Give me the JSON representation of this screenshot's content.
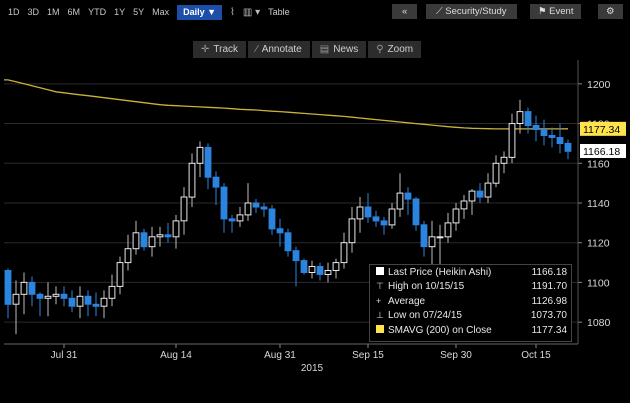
{
  "toolbar": {
    "ranges": [
      "1D",
      "3D",
      "1M",
      "6M",
      "YTD",
      "1Y",
      "5Y",
      "Max"
    ],
    "frequency": "Daily ▼",
    "table_label": "Table",
    "security_study_label": "Security/Study",
    "event_label": "Event"
  },
  "toolbar2": {
    "track": "Track",
    "annotate": "Annotate",
    "news": "News",
    "zoom": "Zoom"
  },
  "legend": {
    "last_price_label": "Last Price (Heikin Ashi)",
    "last_price_value": "1166.18",
    "high_label": "High on 10/15/15",
    "high_value": "1191.70",
    "average_label": "Average",
    "average_value": "1126.98",
    "low_label": "Low on 07/24/15",
    "low_value": "1073.70",
    "sma_label": "SMAVG (200) on Close",
    "sma_value": "1177.34"
  },
  "colors": {
    "up": "#ffffff",
    "down": "#2b84e0",
    "sma": "#c9b23c",
    "sma_tag": "#ffe34d",
    "freq_bg": "#1e4fa8"
  },
  "chart_data": {
    "type": "candlestick",
    "style": "Heikin Ashi",
    "x_tick_labels": [
      "Jul 31",
      "Aug 14",
      "Aug 31",
      "Sep 15",
      "Sep 30",
      "Oct 15"
    ],
    "year_label": "2015",
    "y_ticks": [
      1080,
      1100,
      1120,
      1140,
      1160,
      1180,
      1200
    ],
    "ylim": [
      1069,
      1212
    ],
    "last_price_tag": "1166.18",
    "sma_tag": "1177.34",
    "candles": [
      {
        "o": 1106,
        "h": 1107,
        "l": 1082,
        "c": 1089
      },
      {
        "o": 1089,
        "h": 1101,
        "l": 1074,
        "c": 1094
      },
      {
        "o": 1094,
        "h": 1105,
        "l": 1084,
        "c": 1100
      },
      {
        "o": 1100,
        "h": 1103,
        "l": 1088,
        "c": 1094
      },
      {
        "o": 1094,
        "h": 1095,
        "l": 1083,
        "c": 1092
      },
      {
        "o": 1092,
        "h": 1100,
        "l": 1083,
        "c": 1093
      },
      {
        "o": 1093,
        "h": 1098,
        "l": 1089,
        "c": 1094
      },
      {
        "o": 1094,
        "h": 1098,
        "l": 1088,
        "c": 1092
      },
      {
        "o": 1092,
        "h": 1096,
        "l": 1085,
        "c": 1088
      },
      {
        "o": 1088,
        "h": 1098,
        "l": 1082,
        "c": 1093
      },
      {
        "o": 1093,
        "h": 1096,
        "l": 1083,
        "c": 1089
      },
      {
        "o": 1089,
        "h": 1095,
        "l": 1083,
        "c": 1088
      },
      {
        "o": 1088,
        "h": 1096,
        "l": 1082,
        "c": 1092
      },
      {
        "o": 1092,
        "h": 1104,
        "l": 1088,
        "c": 1098
      },
      {
        "o": 1098,
        "h": 1113,
        "l": 1094,
        "c": 1110
      },
      {
        "o": 1110,
        "h": 1124,
        "l": 1106,
        "c": 1117
      },
      {
        "o": 1117,
        "h": 1131,
        "l": 1114,
        "c": 1125
      },
      {
        "o": 1125,
        "h": 1127,
        "l": 1116,
        "c": 1118
      },
      {
        "o": 1118,
        "h": 1128,
        "l": 1113,
        "c": 1123
      },
      {
        "o": 1123,
        "h": 1128,
        "l": 1118,
        "c": 1124
      },
      {
        "o": 1124,
        "h": 1130,
        "l": 1120,
        "c": 1123
      },
      {
        "o": 1123,
        "h": 1134,
        "l": 1117,
        "c": 1131
      },
      {
        "o": 1131,
        "h": 1148,
        "l": 1124,
        "c": 1143
      },
      {
        "o": 1143,
        "h": 1165,
        "l": 1138,
        "c": 1160
      },
      {
        "o": 1160,
        "h": 1171,
        "l": 1153,
        "c": 1168
      },
      {
        "o": 1168,
        "h": 1170,
        "l": 1147,
        "c": 1153
      },
      {
        "o": 1153,
        "h": 1156,
        "l": 1139,
        "c": 1148
      },
      {
        "o": 1148,
        "h": 1150,
        "l": 1125,
        "c": 1132
      },
      {
        "o": 1132,
        "h": 1134,
        "l": 1125,
        "c": 1131
      },
      {
        "o": 1131,
        "h": 1138,
        "l": 1128,
        "c": 1134
      },
      {
        "o": 1134,
        "h": 1150,
        "l": 1131,
        "c": 1140
      },
      {
        "o": 1140,
        "h": 1142,
        "l": 1135,
        "c": 1138
      },
      {
        "o": 1138,
        "h": 1140,
        "l": 1133,
        "c": 1137
      },
      {
        "o": 1137,
        "h": 1139,
        "l": 1124,
        "c": 1127
      },
      {
        "o": 1127,
        "h": 1132,
        "l": 1118,
        "c": 1125
      },
      {
        "o": 1125,
        "h": 1127,
        "l": 1113,
        "c": 1116
      },
      {
        "o": 1116,
        "h": 1118,
        "l": 1098,
        "c": 1111
      },
      {
        "o": 1111,
        "h": 1112,
        "l": 1104,
        "c": 1105
      },
      {
        "o": 1105,
        "h": 1111,
        "l": 1102,
        "c": 1108
      },
      {
        "o": 1108,
        "h": 1110,
        "l": 1101,
        "c": 1104
      },
      {
        "o": 1104,
        "h": 1110,
        "l": 1100,
        "c": 1106
      },
      {
        "o": 1106,
        "h": 1112,
        "l": 1102,
        "c": 1110
      },
      {
        "o": 1110,
        "h": 1125,
        "l": 1107,
        "c": 1120
      },
      {
        "o": 1120,
        "h": 1138,
        "l": 1115,
        "c": 1132
      },
      {
        "o": 1132,
        "h": 1143,
        "l": 1125,
        "c": 1138
      },
      {
        "o": 1138,
        "h": 1145,
        "l": 1130,
        "c": 1133
      },
      {
        "o": 1133,
        "h": 1136,
        "l": 1128,
        "c": 1131
      },
      {
        "o": 1131,
        "h": 1133,
        "l": 1124,
        "c": 1129
      },
      {
        "o": 1129,
        "h": 1140,
        "l": 1127,
        "c": 1137
      },
      {
        "o": 1137,
        "h": 1155,
        "l": 1133,
        "c": 1145
      },
      {
        "o": 1145,
        "h": 1148,
        "l": 1134,
        "c": 1142
      },
      {
        "o": 1142,
        "h": 1143,
        "l": 1126,
        "c": 1129
      },
      {
        "o": 1129,
        "h": 1131,
        "l": 1113,
        "c": 1118
      },
      {
        "o": 1118,
        "h": 1131,
        "l": 1109,
        "c": 1123
      },
      {
        "o": 1123,
        "h": 1129,
        "l": 1104,
        "c": 1123
      },
      {
        "o": 1123,
        "h": 1135,
        "l": 1120,
        "c": 1130
      },
      {
        "o": 1130,
        "h": 1140,
        "l": 1126,
        "c": 1137
      },
      {
        "o": 1137,
        "h": 1144,
        "l": 1132,
        "c": 1141
      },
      {
        "o": 1141,
        "h": 1147,
        "l": 1134,
        "c": 1146
      },
      {
        "o": 1146,
        "h": 1150,
        "l": 1140,
        "c": 1143
      },
      {
        "o": 1143,
        "h": 1155,
        "l": 1140,
        "c": 1150
      },
      {
        "o": 1150,
        "h": 1164,
        "l": 1148,
        "c": 1160
      },
      {
        "o": 1160,
        "h": 1166,
        "l": 1155,
        "c": 1163
      },
      {
        "o": 1163,
        "h": 1185,
        "l": 1160,
        "c": 1180
      },
      {
        "o": 1180,
        "h": 1192,
        "l": 1175,
        "c": 1186
      },
      {
        "o": 1186,
        "h": 1188,
        "l": 1175,
        "c": 1179
      },
      {
        "o": 1179,
        "h": 1184,
        "l": 1171,
        "c": 1177
      },
      {
        "o": 1177,
        "h": 1182,
        "l": 1169,
        "c": 1174
      },
      {
        "o": 1174,
        "h": 1178,
        "l": 1168,
        "c": 1173
      },
      {
        "o": 1173,
        "h": 1180,
        "l": 1165,
        "c": 1170
      },
      {
        "o": 1170,
        "h": 1172,
        "l": 1162,
        "c": 1166
      }
    ],
    "sma": [
      1202,
      1201,
      1200,
      1199,
      1198,
      1197,
      1196,
      1195.5,
      1195,
      1194.5,
      1194,
      1193.5,
      1193,
      1192.5,
      1192,
      1191.5,
      1191,
      1190.5,
      1190,
      1189.5,
      1189.2,
      1189,
      1188.8,
      1188.6,
      1188.4,
      1188.2,
      1188,
      1187.8,
      1187.5,
      1187.2,
      1187,
      1186.8,
      1186.5,
      1186.2,
      1186,
      1185.7,
      1185.4,
      1185.1,
      1184.8,
      1184.5,
      1184.2,
      1183.9,
      1183.6,
      1183.2,
      1182.8,
      1182.4,
      1182,
      1181.6,
      1181.2,
      1180.8,
      1180.4,
      1180,
      1179.6,
      1179.2,
      1178.8,
      1178.4,
      1178.1,
      1177.8,
      1177.6,
      1177.5,
      1177.4,
      1177.3,
      1177.3,
      1177.3,
      1177.3,
      1177.3,
      1177.3,
      1177.3,
      1177.3,
      1177.3,
      1177.34
    ]
  }
}
